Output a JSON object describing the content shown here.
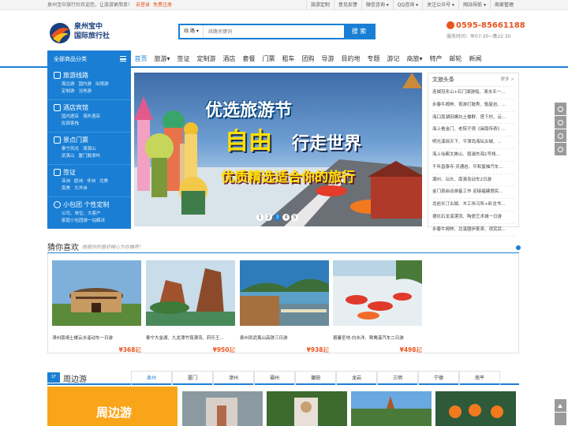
{
  "topbar": {
    "welcome": "泉州宝中旅行社欢迎您，让旅游更简单！",
    "login": "去登录",
    "register": "免费注册",
    "links": [
      "旅游定制",
      "意见反馈",
      "微信咨询 ▾",
      "QQ咨询 ▾",
      "关注公众号 ▾",
      "网站导航 ▾",
      "商家管理"
    ]
  },
  "logo": {
    "line1": "泉州宝中",
    "line2": "国际旅行社"
  },
  "search": {
    "category": "线 路 ▾",
    "placeholder": "线路关键词",
    "button": "搜 索"
  },
  "hotline": {
    "number": "0595-85661188",
    "hours": "服务时间：早07:30~晚22:30"
  },
  "nav": {
    "allcat": "全部商品分类",
    "items": [
      "首页",
      "旅游▾",
      "签证",
      "定制游",
      "酒店",
      "套餐",
      "门票",
      "租车",
      "团购",
      "导游",
      "目的地",
      "专题",
      "游记",
      "商旅▾",
      "特产",
      "邮轮",
      "新闻"
    ]
  },
  "sidebar": [
    {
      "title": "旅游线路",
      "subs": [
        [
          "周边游",
          "国内游",
          "出境游"
        ],
        [
          "定制游",
          "当地游"
        ]
      ]
    },
    {
      "title": "酒店宾馆",
      "subs": [
        [
          "国内酒店",
          "海外酒店"
        ],
        [
          "民宿客栈"
        ]
      ]
    },
    {
      "title": "景点门票",
      "subs": [
        [
          "泰宁风光",
          "清源山"
        ],
        [
          "武夷山",
          "厦门鼓浪屿"
        ]
      ]
    },
    {
      "title": "签证",
      "subs": [
        [
          "亚洲",
          "欧洲",
          "非洲",
          "北美"
        ],
        [
          "南美",
          "大洋洲"
        ]
      ]
    },
    {
      "title": "小包团 个性定制",
      "subs": [
        [
          "公司、单位、大客户"
        ],
        [
          "家庭小包团游一站解决"
        ]
      ]
    }
  ],
  "banner": {
    "line1": "优选旅游节",
    "line2": "自由",
    "line3": "行走世界",
    "line4": "优质精选适合你的旅行",
    "pages": [
      "1",
      "2",
      "3",
      "4",
      "5"
    ],
    "active_page": 3
  },
  "news": {
    "title": "文旅头条",
    "more": "更多 >",
    "items": [
      "连城冠豸山+石门湖游船、清水天一...",
      "永春牛姆林、夜游打鼓秀、魁星岩、...",
      "海口南湖田螺坑土楼群、塔下村、云...",
      "海上看金门、老院子观《闽南传奇》...",
      "明光溪探天下、平潭岛海坛古城、...",
      "海上仙都太姥山、霞浦东海1号栈...",
      "千年昌泰寺·灵通岩、平和蜜柚汽车...",
      "潮州、汕头、南澳岛动车2日游",
      "金门县启动准备工作 迎接福建居民...",
      "龙岩长汀古城、木工伟习所+卧龙书...",
      "德化石龙溪漂流、陶瓷艺术城一日游",
      "永春牛姆林、北溪围伊麦茶、观赏武..."
    ]
  },
  "guess": {
    "title": "猜你喜欢",
    "subtitle": "根据你的喜好精心为你推荐！",
    "cards": [
      {
        "name": "漳州南靖土楼云水谣动车一日游",
        "price": "¥368",
        "suffix": "起"
      },
      {
        "name": "泰宁大金湖、九龙潭竹筏漂流、莳乐王...",
        "price": "¥950",
        "suffix": "起"
      },
      {
        "name": "泉州到武夷山高铁三日游",
        "price": "¥938",
        "suffix": "起"
      },
      {
        "name": "避暑圣地·白水洋、鸳鸯溪汽车二日游",
        "price": "¥498",
        "suffix": "起"
      }
    ]
  },
  "zhoubian": {
    "flag": "1F",
    "title": "周边游",
    "tabs": [
      "泉州",
      "厦门",
      "漳州",
      "福州",
      "莆田",
      "龙岩",
      "三明",
      "宁德",
      "南平"
    ],
    "promo": "周边游"
  },
  "colors": {
    "primary": "#1a7fd4",
    "accent": "#e8541e",
    "promo": "#f9a51a"
  }
}
